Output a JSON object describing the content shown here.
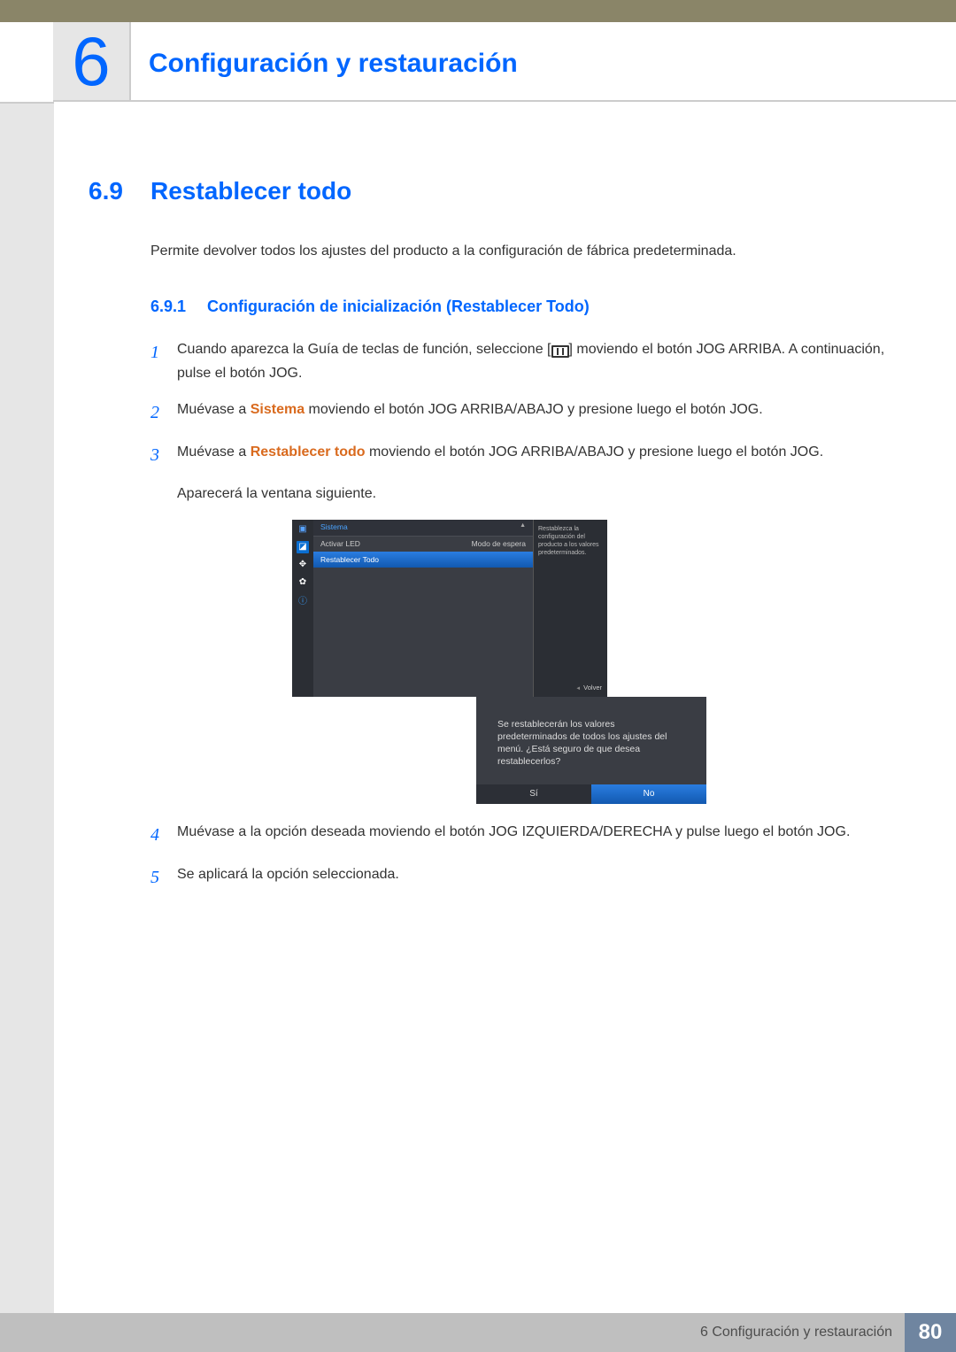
{
  "chapter": {
    "number": "6",
    "title": "Configuración y restauración"
  },
  "section": {
    "number": "6.9",
    "title": "Restablecer todo"
  },
  "intro": "Permite devolver todos los ajustes del producto a la configuración de fábrica predeterminada.",
  "subsection": {
    "number": "6.9.1",
    "title": "Configuración de inicialización (Restablecer Todo)"
  },
  "steps": {
    "s1": {
      "num": "1",
      "pre": "Cuando aparezca la Guía de teclas de función, seleccione [",
      "post": "] moviendo el botón JOG ARRIBA. A continuación, pulse el botón JOG."
    },
    "s2": {
      "num": "2",
      "pre": "Muévase a ",
      "hl": "Sistema",
      "post": " moviendo el botón JOG ARRIBA/ABAJO y presione luego el botón JOG."
    },
    "s3": {
      "num": "3",
      "pre": "Muévase a ",
      "hl": "Restablecer todo",
      "post": " moviendo el botón JOG ARRIBA/ABAJO y presione luego el botón JOG."
    },
    "s3_note": "Aparecerá la ventana siguiente.",
    "s4": {
      "num": "4",
      "text": "Muévase a la opción deseada moviendo el botón JOG IZQUIERDA/DERECHA y pulse luego el botón JOG."
    },
    "s5": {
      "num": "5",
      "text": "Se aplicará la opción seleccionada."
    }
  },
  "osd": {
    "header": "Sistema",
    "row1": {
      "label": "Activar LED",
      "value": "Modo de espera"
    },
    "row2": "Restablecer Todo",
    "tip": "Restablezca la configuración del producto a los valores predeterminados.",
    "return": "Volver"
  },
  "dialog": {
    "text": "Se restablecerán los valores predeterminados de todos los ajustes del menú. ¿Está seguro de que desea restablecerlos?",
    "yes": "Sí",
    "no": "No"
  },
  "footer": {
    "label": "6 Configuración y restauración",
    "page": "80"
  }
}
